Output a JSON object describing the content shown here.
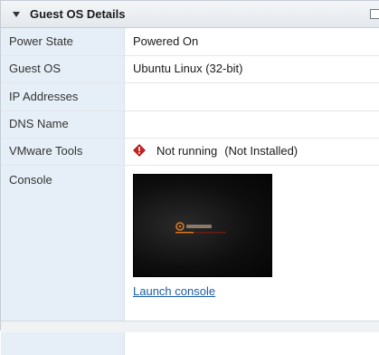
{
  "panel": {
    "title": "Guest OS Details",
    "collapse_icon": "triangle-down-icon",
    "maximize_icon": "maximize-icon"
  },
  "rows": {
    "power_state": {
      "label": "Power State",
      "value": "Powered On"
    },
    "guest_os": {
      "label": "Guest OS",
      "value": "Ubuntu Linux (32-bit)"
    },
    "ip_addresses": {
      "label": "IP Addresses",
      "value": ""
    },
    "dns_name": {
      "label": "DNS Name",
      "value": ""
    },
    "vmware_tools": {
      "label": "VMware Tools",
      "status": "Not running",
      "detail": "(Not Installed)",
      "status_icon": "warning-diamond-icon",
      "status_color": "#cc1f1f"
    },
    "console": {
      "label": "Console",
      "thumbnail": "console-screen-thumbnail",
      "launch_label": "Launch console"
    }
  },
  "colors": {
    "label_column": "#e6eff7",
    "link": "#1a5ea8",
    "header_gradient_top": "#f4f6f8",
    "header_gradient_bottom": "#e4e8ec"
  }
}
